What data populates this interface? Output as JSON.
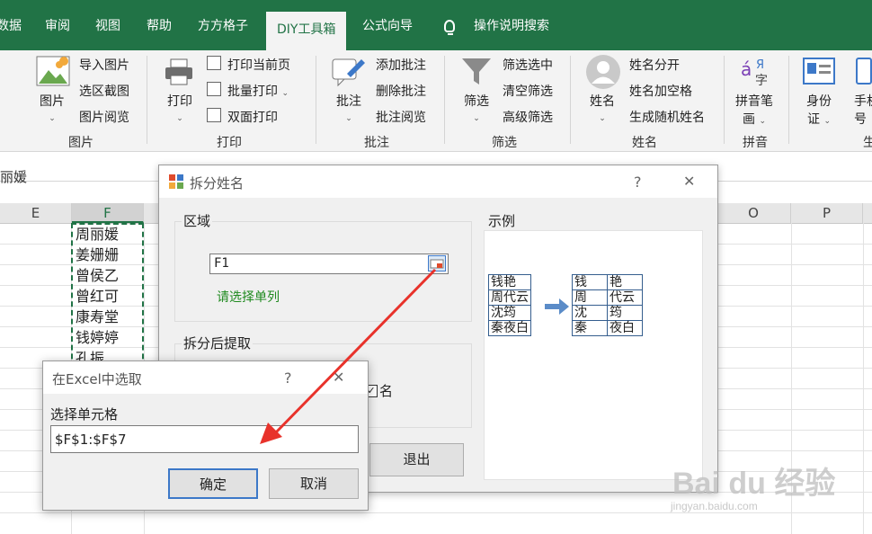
{
  "ribbon_tabs": [
    "数据",
    "审阅",
    "视图",
    "帮助",
    "方方格子",
    "DIY工具箱",
    "公式向导",
    "操作说明搜索"
  ],
  "ribbon": {
    "picture": {
      "big": "图片",
      "items": [
        "导入图片",
        "选区截图",
        "图片阅览"
      ],
      "group": "图片"
    },
    "print": {
      "big": "打印",
      "items": [
        "打印当前页",
        "批量打印",
        "双面打印"
      ],
      "group": "打印"
    },
    "comment": {
      "big": "批注",
      "items": [
        "添加批注",
        "删除批注",
        "批注阅览"
      ],
      "group": "批注"
    },
    "filter": {
      "big": "筛选",
      "items": [
        "筛选选中",
        "清空筛选",
        "高级筛选"
      ],
      "group": "筛选"
    },
    "name": {
      "big": "姓名",
      "items": [
        "姓名分开",
        "姓名加空格",
        "生成随机姓名"
      ],
      "group": "姓名"
    },
    "pinyin": {
      "big_1": "拼音笔",
      "big_2": "画",
      "group": "拼音"
    },
    "id": {
      "big_1": "身份",
      "big_2": "证",
      "partial_1": "手机",
      "partial_2": "号",
      "partial_group": "生"
    }
  },
  "formula_bar": {
    "text": "丽媛"
  },
  "columns": [
    "E",
    "F",
    "O",
    "P"
  ],
  "cells_F": [
    "周丽媛",
    "姜姗姗",
    "曾侯乙",
    "曾红可",
    "康寿堂",
    "钱婷婷",
    "孔振"
  ],
  "dialog_split": {
    "title": "拆分姓名",
    "help": "?",
    "close": "✕",
    "area_label": "区域",
    "range_value": "F1",
    "hint": "请选择单列",
    "extract_label": "拆分后提取",
    "checkbox_label": "名",
    "exit_button": "退出",
    "example_label": "示例",
    "example_before": [
      "钱艳",
      "周代云",
      "沈筠",
      "秦夜白"
    ],
    "example_after": [
      [
        "钱",
        "艳"
      ],
      [
        "周",
        "代云"
      ],
      [
        "沈",
        "筠"
      ],
      [
        "秦",
        "夜白"
      ]
    ]
  },
  "dialog_select": {
    "title": "在Excel中选取",
    "help": "?",
    "close": "✕",
    "field_label": "选择单元格",
    "field_value": "$F$1:$F$7",
    "ok": "确定",
    "cancel": "取消"
  },
  "watermark": {
    "text": "Bai du 经验",
    "url": "jingyan.baidu.com"
  },
  "colors": {
    "excel_green": "#217346",
    "annotation_red": "#e8322b",
    "hint_green": "#1f8a1f"
  }
}
